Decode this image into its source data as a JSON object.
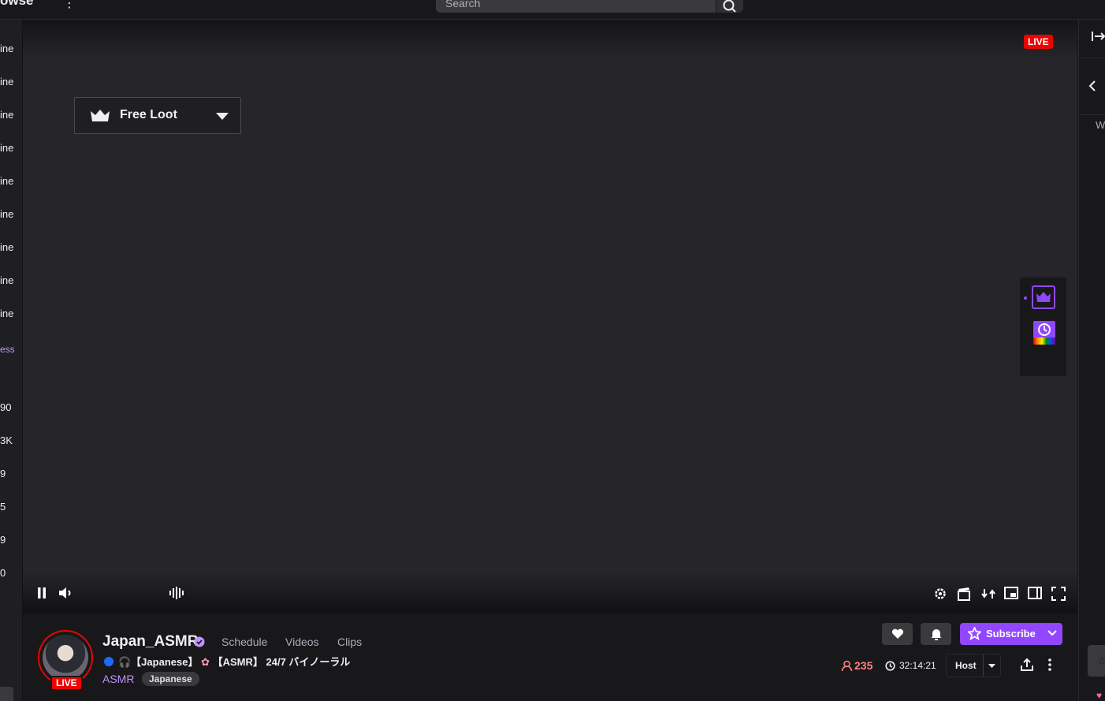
{
  "topnav": {
    "browse_label": "owse",
    "search_placeholder": "Search"
  },
  "sidebar": {
    "items": [
      "ine",
      "ine",
      "ine",
      "ine",
      "ine",
      "ine",
      "ine",
      "ine",
      "ine"
    ],
    "accent_item": "ess",
    "counts": [
      "90",
      "3K",
      "9",
      "5",
      "9",
      "0"
    ]
  },
  "player": {
    "live_label": "LIVE",
    "free_loot_label": "Free Loot"
  },
  "rightcol": {
    "partial_text": "W"
  },
  "channel": {
    "name": "Japan_ASMR",
    "tabs": [
      "Schedule",
      "Videos",
      "Clips"
    ],
    "title_prefix": "🎧【Japanese】",
    "title_flower": "✿",
    "title_suffix": "【ASMR】 24/7 バイノーラル",
    "category": "ASMR",
    "tag": "Japanese",
    "avatar_live": "LIVE",
    "viewers": "235",
    "uptime": "32:14:21",
    "host_label": "Host",
    "subscribe_label": "Subscribe"
  },
  "colors": {
    "accent": "#9147ff",
    "live": "#eb0400",
    "viewer_count": "#ff8280"
  }
}
